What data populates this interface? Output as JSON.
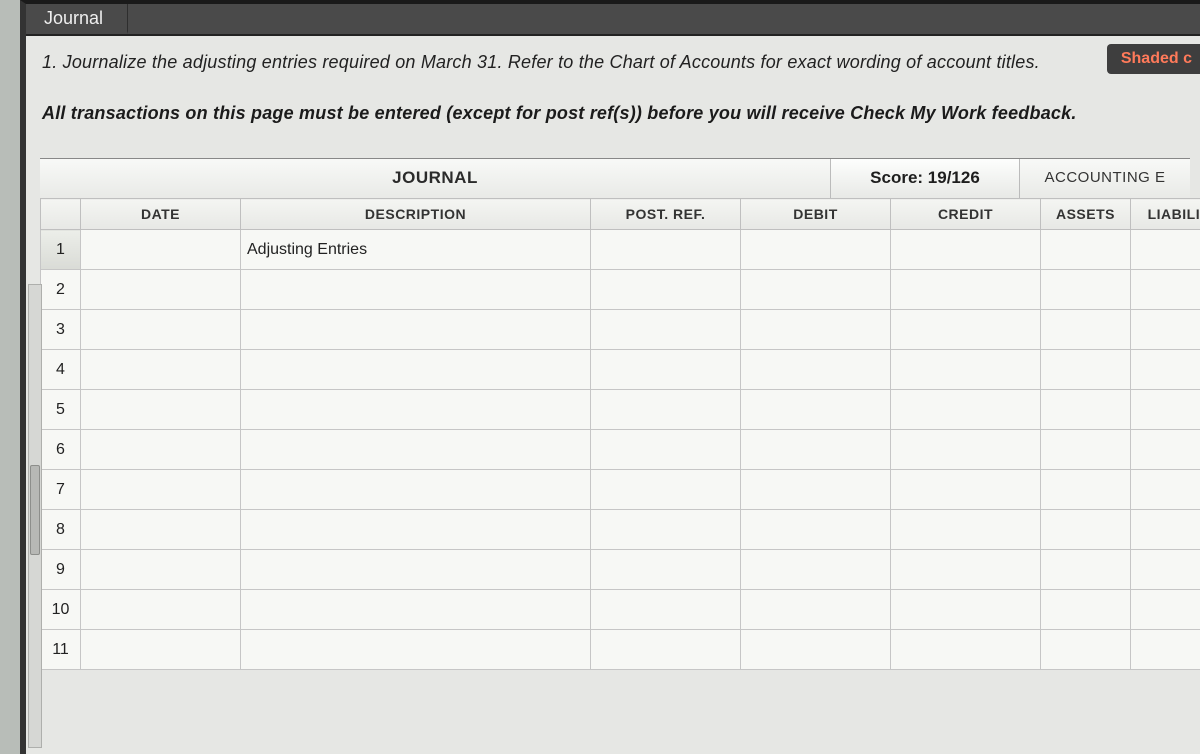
{
  "tab": {
    "label": "Journal"
  },
  "shaded_button": "Shaded c",
  "instruction": "1. Journalize the adjusting entries required on March 31. Refer to the Chart of Accounts for exact wording of account titles.",
  "subnote": "All transactions on this page must be entered (except for post ref(s)) before you will receive Check My Work feedback.",
  "journal": {
    "title": "JOURNAL",
    "score_label": "Score: 19/126",
    "acct_eq_label": "ACCOUNTING E",
    "columns": {
      "date": "DATE",
      "description": "DESCRIPTION",
      "post_ref": "POST. REF.",
      "debit": "DEBIT",
      "credit": "CREDIT",
      "assets": "ASSETS",
      "liabilities": "LIABILITIE"
    },
    "rows": [
      {
        "n": "1",
        "date": "",
        "description": "Adjusting Entries",
        "post_ref": "",
        "debit": "",
        "credit": "",
        "assets": "",
        "liabilities": ""
      },
      {
        "n": "2",
        "date": "",
        "description": "",
        "post_ref": "",
        "debit": "",
        "credit": "",
        "assets": "",
        "liabilities": ""
      },
      {
        "n": "3",
        "date": "",
        "description": "",
        "post_ref": "",
        "debit": "",
        "credit": "",
        "assets": "",
        "liabilities": ""
      },
      {
        "n": "4",
        "date": "",
        "description": "",
        "post_ref": "",
        "debit": "",
        "credit": "",
        "assets": "",
        "liabilities": ""
      },
      {
        "n": "5",
        "date": "",
        "description": "",
        "post_ref": "",
        "debit": "",
        "credit": "",
        "assets": "",
        "liabilities": ""
      },
      {
        "n": "6",
        "date": "",
        "description": "",
        "post_ref": "",
        "debit": "",
        "credit": "",
        "assets": "",
        "liabilities": ""
      },
      {
        "n": "7",
        "date": "",
        "description": "",
        "post_ref": "",
        "debit": "",
        "credit": "",
        "assets": "",
        "liabilities": ""
      },
      {
        "n": "8",
        "date": "",
        "description": "",
        "post_ref": "",
        "debit": "",
        "credit": "",
        "assets": "",
        "liabilities": ""
      },
      {
        "n": "9",
        "date": "",
        "description": "",
        "post_ref": "",
        "debit": "",
        "credit": "",
        "assets": "",
        "liabilities": ""
      },
      {
        "n": "10",
        "date": "",
        "description": "",
        "post_ref": "",
        "debit": "",
        "credit": "",
        "assets": "",
        "liabilities": ""
      },
      {
        "n": "11",
        "date": "",
        "description": "",
        "post_ref": "",
        "debit": "",
        "credit": "",
        "assets": "",
        "liabilities": ""
      }
    ]
  }
}
